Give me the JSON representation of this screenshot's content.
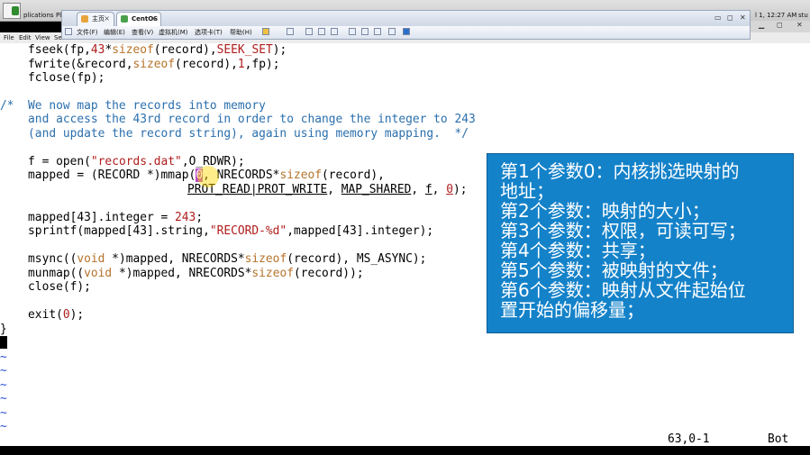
{
  "desktop": {
    "menu_applications": "plications",
    "menu_places": "Pl",
    "clock": "l 1, 12:27 AM",
    "user": "stu"
  },
  "browser": {
    "tabs": [
      {
        "label": "主页"
      },
      {
        "label": "CentOS"
      }
    ],
    "toolbar": {
      "file": "文件(F)",
      "edit": "编辑(E)",
      "view": "查看(V)",
      "vm": "虚拟机(M)",
      "tabs": "选项卡(T)",
      "help": "帮助(H)"
    }
  },
  "terminal_menu": {
    "file": "File",
    "edit": "Edit",
    "view": "View",
    "search": "Se"
  },
  "code": {
    "l1_pre": "    fseek(fp,",
    "l1_num": "43",
    "l1_star": "*",
    "l1_kw": "sizeof",
    "l1_arg": "(record),",
    "l1_const": "SEEK_SET",
    "l1_end": ");",
    "l2_pre": "    fwrite(&record,",
    "l2_kw": "sizeof",
    "l2_mid": "(record),",
    "l2_num": "1",
    "l2_end": ",fp);",
    "l3": "    fclose(fp);",
    "c1": "/*  We now map the records into memory",
    "c2": "    and access the 43rd record in order to change the integer to 243",
    "c3": "    (and update the record string), again using memory mapping.  */",
    "l4_pre": "    f = open(",
    "l4_str": "\"records.dat\"",
    "l4_post": ",O_RDWR);",
    "l5_pre": "    mapped = (RECORD *)mmap(",
    "l5_hl": "0",
    "l5_post": ", NRECORDS*",
    "l5_kw": "sizeof",
    "l5_end": "(record),",
    "l6_a": "PROT_READ|PROT_WRITE",
    "l6_b": ", ",
    "l6_c": "MAP_SHARED",
    "l6_d": ", ",
    "l6_e": "f",
    "l6_f": ", ",
    "l6_g": "0",
    "l6_h": ");",
    "l7_pre": "    mapped[43].integer = ",
    "l7_num": "243",
    "l7_end": ";",
    "l8_pre": "    sprintf(mapped[43].string,",
    "l8_str": "\"RECORD-%d\"",
    "l8_end": ",mapped[43].integer);",
    "l9_pre": "    msync((",
    "l9_kw": "void",
    "l9_end": " *)mapped, NRECORDS*",
    "l9_kw2": "sizeof",
    "l9_tail": "(record), MS_ASYNC);",
    "l10_pre": "    munmap((",
    "l10_kw": "void",
    "l10_mid": " *)mapped, NRECORDS*",
    "l10_kw2": "sizeof",
    "l10_end": "(record));",
    "l11": "    close(f);",
    "l12_pre": "    exit(",
    "l12_num": "0",
    "l12_end": ");",
    "brace": "}",
    "tilde": "~"
  },
  "status": {
    "position": "63,0-1",
    "scroll": "Bot"
  },
  "annotation": {
    "lines": [
      "第1个参数0：内核挑选映射的",
      "地址；",
      "第2个参数：映射的大小；",
      "第3个参数：权限，可读可写；",
      "第4个参数：共享；",
      "第5个参数：被映射的文件；",
      "第6个参数：映射从文件起始位",
      "置开始的偏移量；"
    ]
  },
  "colors": {
    "keyword": "#b5732b",
    "string": "#b01c1c",
    "comment": "#2a6fad",
    "annotation_bg": "#1482c9",
    "highlight": "#b84ac3"
  }
}
